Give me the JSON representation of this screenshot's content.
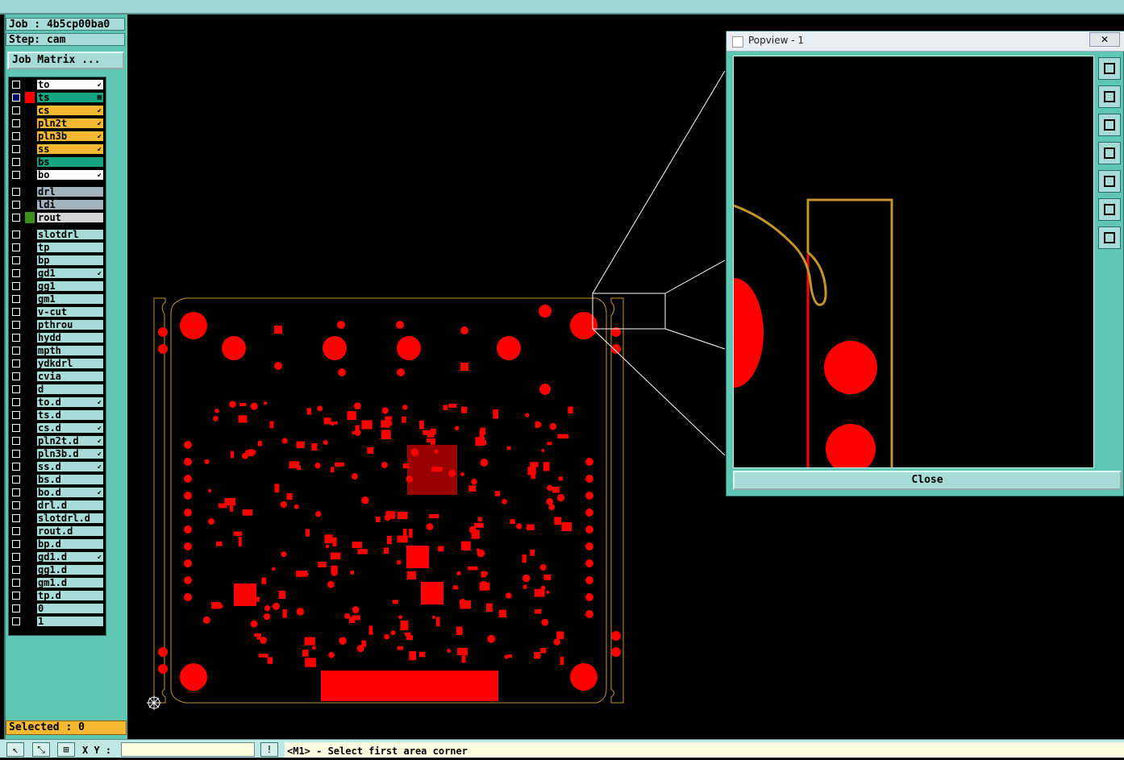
{
  "job": {
    "label": "Job : 4b5cp00ba0",
    "step": "Step: cam"
  },
  "job_matrix_label": "Job Matrix ...",
  "layers": [
    {
      "name": "to",
      "color": "#ffffff",
      "mark": "↙"
    },
    {
      "name": "ts",
      "color": "#16a382",
      "mark": "▦",
      "active": true
    },
    {
      "name": "cs",
      "color": "#f4b833",
      "mark": "↙"
    },
    {
      "name": "pln2t",
      "color": "#f4b833",
      "mark": "↙"
    },
    {
      "name": "pln3b",
      "color": "#f4b833",
      "mark": "↙"
    },
    {
      "name": "ss",
      "color": "#f4b833",
      "mark": "↙"
    },
    {
      "name": "bs",
      "color": "#16a382",
      "mark": ""
    },
    {
      "name": "bo",
      "color": "#ffffff",
      "mark": "↙"
    },
    {
      "name": "drl",
      "color": "#a3b3bd",
      "mark": ""
    },
    {
      "name": "ldi",
      "color": "#a3b3bd",
      "mark": ""
    },
    {
      "name": "rout",
      "color": "#d6d6d6",
      "mark": ""
    },
    {
      "name": "slotdrl",
      "color": "#a6dbd8",
      "mark": ""
    },
    {
      "name": "tp",
      "color": "#a6dbd8",
      "mark": ""
    },
    {
      "name": "bp",
      "color": "#a6dbd8",
      "mark": ""
    },
    {
      "name": "gd1",
      "color": "#a6dbd8",
      "mark": "↙"
    },
    {
      "name": "gg1",
      "color": "#a6dbd8",
      "mark": ""
    },
    {
      "name": "gm1",
      "color": "#a6dbd8",
      "mark": ""
    },
    {
      "name": "v-cut",
      "color": "#a6dbd8",
      "mark": ""
    },
    {
      "name": "pthrou",
      "color": "#a6dbd8",
      "mark": ""
    },
    {
      "name": "hydd",
      "color": "#a6dbd8",
      "mark": ""
    },
    {
      "name": "mpth",
      "color": "#a6dbd8",
      "mark": ""
    },
    {
      "name": "ydkdrl",
      "color": "#a6dbd8",
      "mark": ""
    },
    {
      "name": "cvia",
      "color": "#a6dbd8",
      "mark": ""
    },
    {
      "name": "d",
      "color": "#a6dbd8",
      "mark": ""
    },
    {
      "name": "to.d",
      "color": "#a6dbd8",
      "mark": "↙"
    },
    {
      "name": "ts.d",
      "color": "#a6dbd8",
      "mark": ""
    },
    {
      "name": "cs.d",
      "color": "#a6dbd8",
      "mark": "↙"
    },
    {
      "name": "pln2t.d",
      "color": "#a6dbd8",
      "mark": "↙"
    },
    {
      "name": "pln3b.d",
      "color": "#a6dbd8",
      "mark": "↙"
    },
    {
      "name": "ss.d",
      "color": "#a6dbd8",
      "mark": "↙"
    },
    {
      "name": "bs.d",
      "color": "#a6dbd8",
      "mark": ""
    },
    {
      "name": "bo.d",
      "color": "#a6dbd8",
      "mark": "↙"
    },
    {
      "name": "drl.d",
      "color": "#a6dbd8",
      "mark": ""
    },
    {
      "name": "slotdrl.d",
      "color": "#a6dbd8",
      "mark": ""
    },
    {
      "name": "rout.d",
      "color": "#a6dbd8",
      "mark": ""
    },
    {
      "name": "bp.d",
      "color": "#a6dbd8",
      "mark": ""
    },
    {
      "name": "gd1.d",
      "color": "#a6dbd8",
      "mark": "↙"
    },
    {
      "name": "gg1.d",
      "color": "#a6dbd8",
      "mark": ""
    },
    {
      "name": "gm1.d",
      "color": "#a6dbd8",
      "mark": ""
    },
    {
      "name": "tp.d",
      "color": "#a6dbd8",
      "mark": ""
    },
    {
      "name": "0",
      "color": "#a6dbd8",
      "mark": ""
    },
    {
      "name": "1",
      "color": "#a6dbd8",
      "mark": ""
    }
  ],
  "selected_label": "Selected : 0",
  "xy_label": "X Y :",
  "xy_value": "",
  "prompt": "<M1> - Select first area corner",
  "popview": {
    "title": "Popview - 1",
    "close_x": "✕",
    "close_label": "Close"
  },
  "colors": {
    "copper": "#ff0000",
    "outline": "#c2962a",
    "panel": "#5fc6b2"
  }
}
